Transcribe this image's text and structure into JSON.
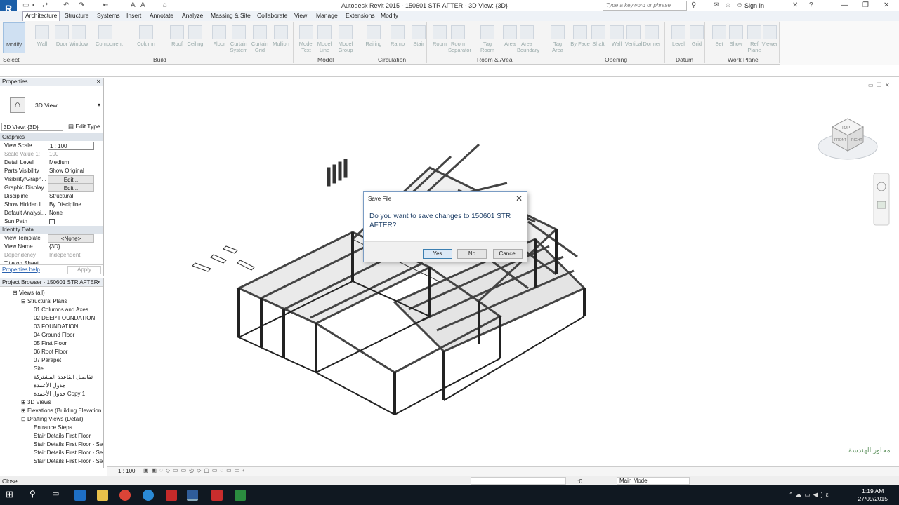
{
  "window": {
    "title": "Autodesk Revit 2015 -     150601 STR AFTER - 3D View: {3D}",
    "search_placeholder": "Type a keyword or phrase",
    "sign_in": "Sign In",
    "app_button": "R"
  },
  "tabs": [
    "Architecture",
    "Structure",
    "Systems",
    "Insert",
    "Annotate",
    "Analyze",
    "Massing & Site",
    "Collaborate",
    "View",
    "Manage",
    "Extensions",
    "Modify"
  ],
  "ribbon": {
    "modify": "Modify",
    "buttons": [
      "Wall",
      "Door",
      "Window",
      "Component",
      "Column",
      "Roof",
      "Ceiling",
      "Floor",
      "Curtain System",
      "Curtain Grid",
      "Mullion",
      "Model Text",
      "Model Line",
      "Model Group",
      "Railing",
      "Ramp",
      "Stair",
      "Room",
      "Room Separator",
      "Tag Room",
      "Area",
      "Area Boundary",
      "Tag Area",
      "By Face",
      "Shaft",
      "Wall",
      "Vertical",
      "Dormer",
      "Level",
      "Grid",
      "Set",
      "Show",
      "Ref Plane",
      "Viewer"
    ],
    "panels": [
      "Select",
      "Build",
      "Model",
      "Circulation",
      "Room & Area",
      "Opening",
      "Datum",
      "Work Plane"
    ]
  },
  "properties": {
    "header": "Properties",
    "type_name": "3D View",
    "view_selector": "3D View: {3D}",
    "edit_type": "Edit Type",
    "groups": [
      "Graphics",
      "Identity Data"
    ],
    "rows": [
      {
        "k": "View Scale",
        "v": "1 : 100"
      },
      {
        "k": "Scale Value    1:",
        "v": "100"
      },
      {
        "k": "Detail Level",
        "v": "Medium"
      },
      {
        "k": "Parts Visibility",
        "v": "Show Original"
      },
      {
        "k": "Visibility/Graph...",
        "v": "Edit..."
      },
      {
        "k": "Graphic Display...",
        "v": "Edit..."
      },
      {
        "k": "Discipline",
        "v": "Structural"
      },
      {
        "k": "Show Hidden L...",
        "v": "By Discipline"
      },
      {
        "k": "Default Analysi...",
        "v": "None"
      },
      {
        "k": "Sun Path",
        "v": ""
      },
      {
        "k": "View Template",
        "v": "<None>"
      },
      {
        "k": "View Name",
        "v": "{3D}"
      },
      {
        "k": "Dependency",
        "v": "Independent"
      },
      {
        "k": "Title on Sheet",
        "v": ""
      }
    ],
    "help": "Properties help",
    "apply": "Apply"
  },
  "browser": {
    "header": "Project Browser - 150601 STR AFTER",
    "items": [
      "Views (all)",
      "Structural Plans",
      "01 Columns and Axes",
      "02 DEEP FOUNDATION",
      "03 FOUNDATION",
      "04 Ground Floor",
      "05 First Floor",
      "06 Roof Floor",
      "07 Parapet",
      "Site",
      "تفاصيل القاعدة المشتركة",
      "جدول الأعمدة",
      "جدول الأعمدة Copy 1",
      "3D Views",
      "Elevations (Building Elevation",
      "Drafting Views (Detail)",
      "Entrance Steps",
      "Stair Details First Floor",
      "Stair Details First Floor - Se",
      "Stair Details First Floor - Se",
      "Stair Details First Floor - Se"
    ]
  },
  "dialog": {
    "title": "Save File",
    "message": "Do you want to save changes to 150601 STR AFTER?",
    "yes": "Yes",
    "no": "No",
    "cancel": "Cancel"
  },
  "viewcube": {
    "top": "TOP",
    "front": "FRONT",
    "right": "RIGHT"
  },
  "viewbar": {
    "scale": "1 : 100"
  },
  "status": {
    "left": "Close",
    "filter": ":0",
    "model": "Main Model"
  },
  "clock": {
    "time": "1:19 AM",
    "date": "27/09/2015"
  },
  "watermark": "محاور الهندسة"
}
